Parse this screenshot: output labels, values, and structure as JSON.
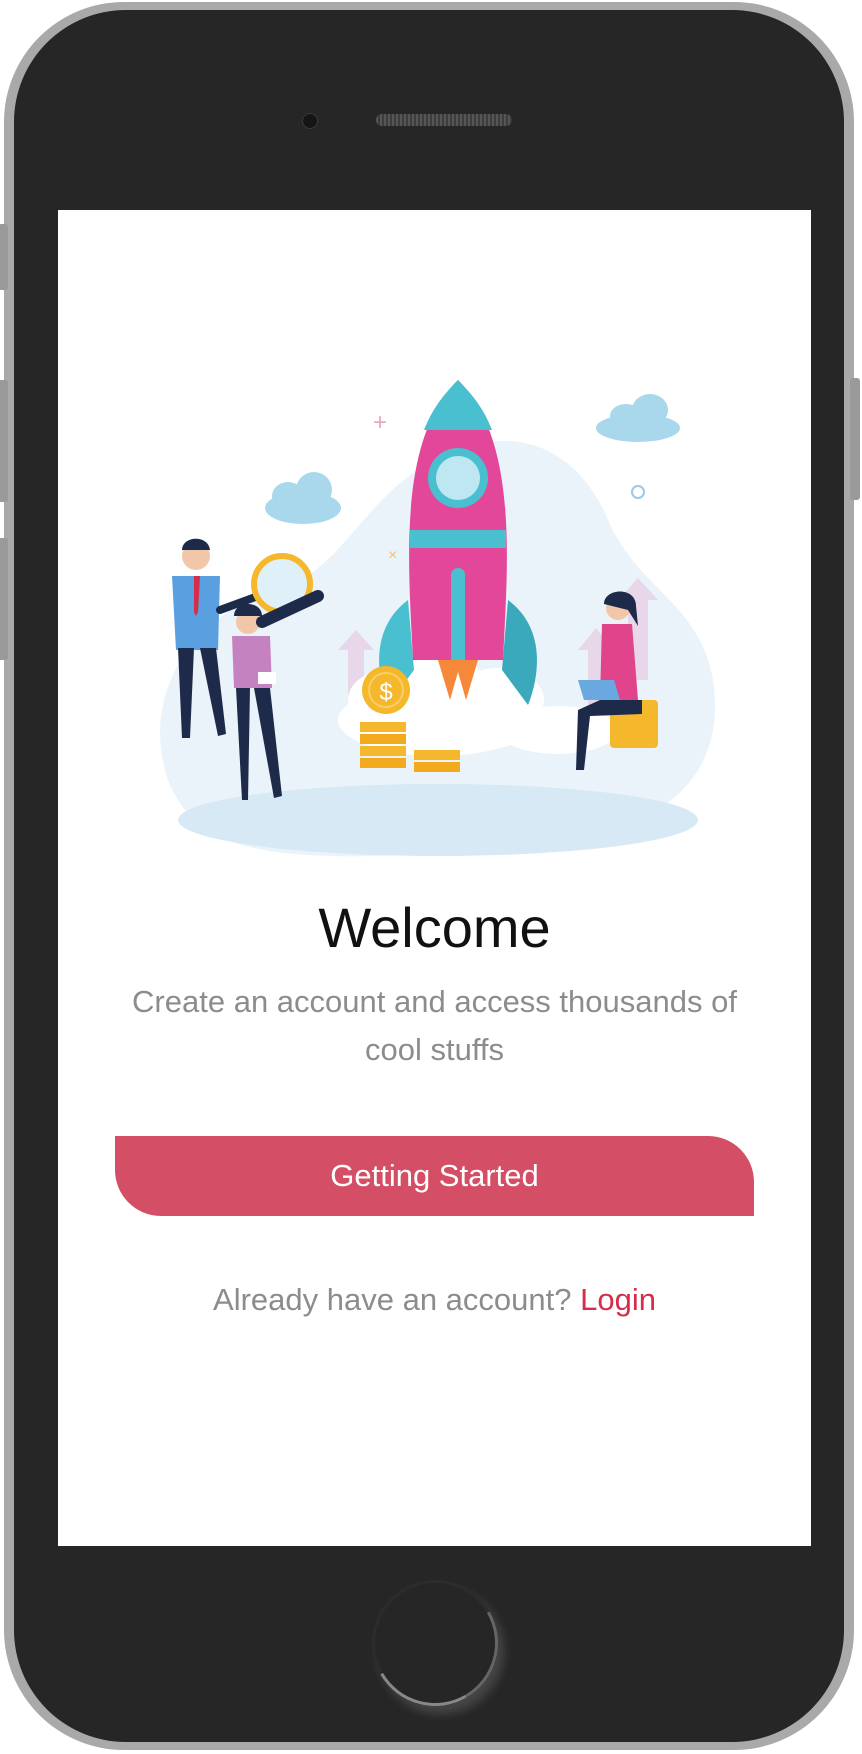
{
  "welcome": {
    "title": "Welcome",
    "subtitle": "Create an account and access thousands of cool stuffs"
  },
  "cta": {
    "label": "Getting Started"
  },
  "login": {
    "prompt": "Already have an account?",
    "link_label": "Login"
  },
  "illustration": {
    "icon": "rocket-launch-illustration",
    "coin_symbol": "$"
  },
  "colors": {
    "accent": "#d44f65",
    "link": "#d42e4b",
    "rocket": "#e3479a",
    "rocket_trim": "#49bfd0",
    "coin": "#f5b72b",
    "bezel": "#262626"
  }
}
